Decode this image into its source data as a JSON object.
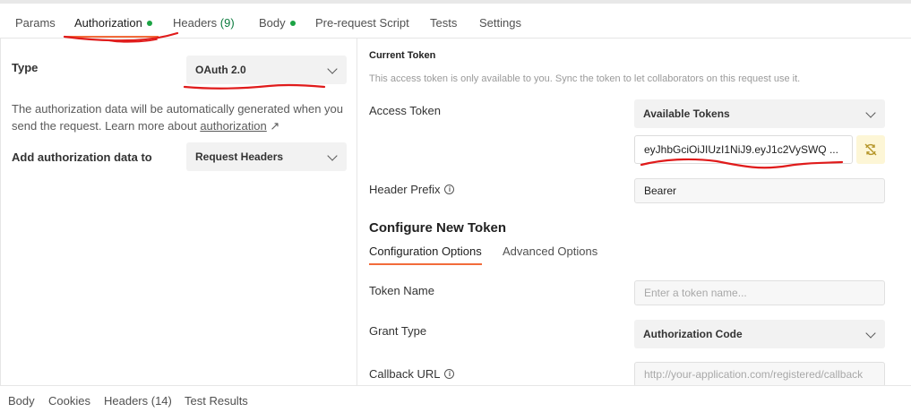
{
  "tabs": [
    {
      "label": "Params"
    },
    {
      "label": "Authorization",
      "dot": true
    },
    {
      "label": "Headers",
      "count": "(9)"
    },
    {
      "label": "Body",
      "dot": true
    },
    {
      "label": "Pre-request Script"
    },
    {
      "label": "Tests"
    },
    {
      "label": "Settings"
    }
  ],
  "left": {
    "type_label": "Type",
    "type_value": "OAuth 2.0",
    "description_prefix": "The authorization data will be automatically generated when you send the request. Learn more about ",
    "description_link": "authorization",
    "description_arrow": "↗",
    "add_to_label": "Add authorization data to",
    "add_to_value": "Request Headers"
  },
  "right": {
    "current_token_title": "Current Token",
    "current_token_note": "This access token is only available to you. Sync the token to let collaborators on this request use it.",
    "access_token_label": "Access Token",
    "available_tokens": "Available Tokens",
    "token_value": "eyJhbGciOiJIUzI1NiJ9.eyJ1c2VySWQ ...",
    "header_prefix_label": "Header Prefix",
    "header_prefix_value": "Bearer",
    "configure_title": "Configure New Token",
    "subtabs": [
      "Configuration Options",
      "Advanced Options"
    ],
    "token_name_label": "Token Name",
    "token_name_placeholder": "Enter a token name...",
    "grant_type_label": "Grant Type",
    "grant_type_value": "Authorization Code",
    "callback_url_label": "Callback URL",
    "callback_url_placeholder": "http://your-application.com/registered/callback"
  },
  "bottom_tabs": [
    {
      "label": "Body"
    },
    {
      "label": "Cookies"
    },
    {
      "label": "Headers (14)"
    },
    {
      "label": "Test Results"
    }
  ],
  "colors": {
    "accent": "#f26b3a",
    "dot": "#1ba344",
    "annotation": "#e01b1b"
  },
  "icons": {
    "sync": "sync-token-icon",
    "info": "info-icon",
    "chevron": "chevron-down-icon"
  }
}
